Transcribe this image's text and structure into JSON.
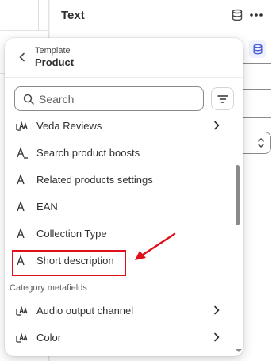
{
  "editor": {
    "panel_title": "Text"
  },
  "popover": {
    "header": {
      "subtitle": "Template",
      "title": "Product"
    },
    "search": {
      "placeholder": "Search",
      "value": ""
    },
    "items": [
      {
        "label": "Veda Reviews",
        "icon": "metafield-group-icon",
        "has_chevron": true
      },
      {
        "label": "Search product boosts",
        "icon": "text-type-icon",
        "has_chevron": false
      },
      {
        "label": "Related products settings",
        "icon": "text-type-icon",
        "has_chevron": false
      },
      {
        "label": "EAN",
        "icon": "text-type-icon",
        "has_chevron": false
      },
      {
        "label": "Collection Type",
        "icon": "text-type-icon",
        "has_chevron": false
      },
      {
        "label": "Short description",
        "icon": "text-type-icon",
        "has_chevron": false,
        "highlighted": true
      }
    ],
    "section_label": "Category metafields",
    "category_items": [
      {
        "label": "Audio output channel",
        "icon": "metafield-group-icon",
        "has_chevron": true
      },
      {
        "label": "Color",
        "icon": "metafield-group-icon",
        "has_chevron": true
      }
    ]
  },
  "colors": {
    "annotation_red": "#e0101a",
    "text": "#303030",
    "accent_blue": "#4a5dd0"
  }
}
